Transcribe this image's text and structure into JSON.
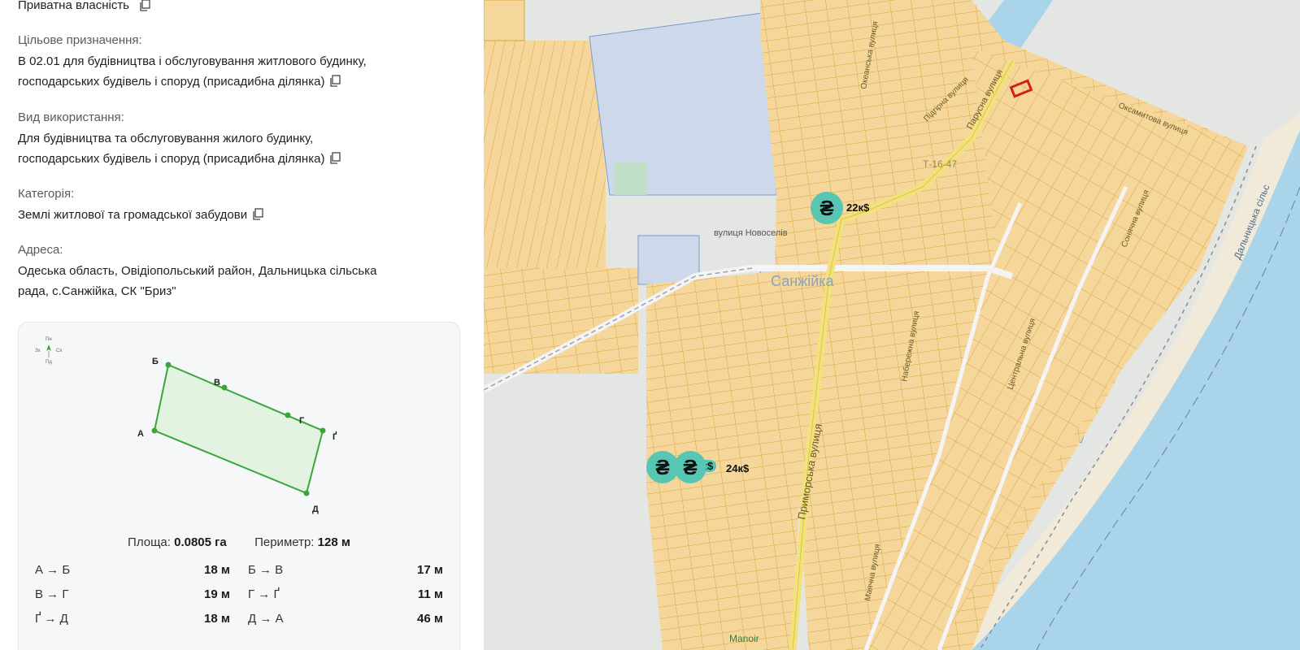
{
  "panel": {
    "ownership": "Приватна власність",
    "purpose": {
      "label": "Цільове призначення:",
      "line1": "В 02.01 для будівництва і обслуговування житлового будинку,",
      "line2": "господарських будівель і споруд (присадибна ділянка)"
    },
    "usage": {
      "label": "Вид використання:",
      "line1": "Для будівництва та обслуговування жилого будинку,",
      "line2": "господарських будівель і споруд (присадибна ділянка)"
    },
    "category": {
      "label": "Категорія:",
      "value": "Землі житлової та громадської забудови"
    },
    "address": {
      "label": "Адреса:",
      "line1": "Одеська область, Овідіопольський район, Дальницька сільська",
      "line2": "рада, с.Санжійка, СК \"Бриз\""
    }
  },
  "parcel": {
    "compass": {
      "n": "Пн",
      "s": "Пд",
      "w": "Зх",
      "e": "Сх"
    },
    "vertices": [
      "А",
      "Б",
      "В",
      "Г",
      "Ґ",
      "Д"
    ],
    "area_label": "Площа:",
    "area_value": "0.0805 га",
    "perimeter_label": "Периметр:",
    "perimeter_value": "128 м",
    "segments": [
      {
        "name": "А → Б",
        "length": "18 м"
      },
      {
        "name": "Б → В",
        "length": "17 м"
      },
      {
        "name": "В → Г",
        "length": "19 м"
      },
      {
        "name": "Г → Ґ",
        "length": "11 м"
      },
      {
        "name": "Ґ → Д",
        "length": "18 м"
      },
      {
        "name": "Д → А",
        "length": "46 м"
      }
    ],
    "colors": {
      "outline": "#3aa63a",
      "fill": "#e3f3e1"
    }
  },
  "map": {
    "labels": {
      "village": "Санжійка",
      "novosela": "вулиця Новоселів",
      "prymorska": "Приморська вулиця",
      "parusna": "Парусна вулиця",
      "okeanska": "Океанська вулиця",
      "oksamytova": "Оксамитова вулиця",
      "pidgirna": "Підгірна вулиця",
      "naberezhna": "Набережна вулиця",
      "tsentralna": "Центральна вулиця",
      "sonyachna": "Сонячна вулиця",
      "mayachna": "Маячна вулиця",
      "dalnytska": "Дальницька сільс",
      "road_code": "Т-16-47",
      "manoir": "Manoir"
    },
    "markers": [
      {
        "symbol": "₴",
        "label": "22к$"
      },
      {
        "symbol": "₴",
        "label": "16к$"
      },
      {
        "symbol": "₴",
        "label": "24к$"
      }
    ],
    "colors": {
      "parcel": "#f6d79b",
      "parcel_edge": "#d9a441",
      "sea": "#a9d4ea",
      "beach": "#f2ead8",
      "road": "#f3e27a",
      "highlight": "#d81b1b",
      "marker": "#57c7b4"
    }
  }
}
